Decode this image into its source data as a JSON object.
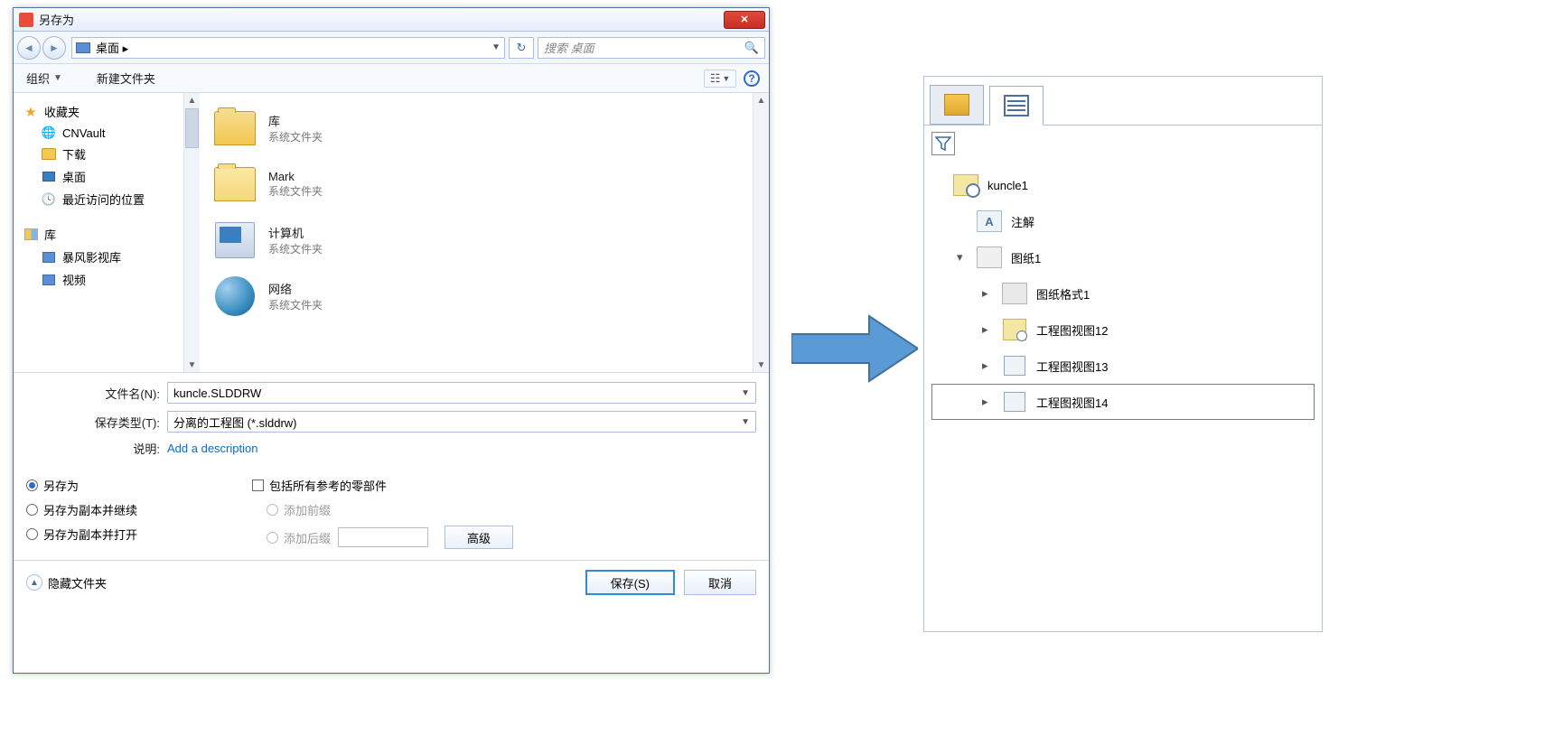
{
  "dialog": {
    "title": "另存为",
    "breadcrumb": "桌面  ▸",
    "search_placeholder": "搜索 桌面",
    "toolbar": {
      "organize": "组织",
      "new_folder": "新建文件夹"
    },
    "sidebar": {
      "favorites": "收藏夹",
      "cnvault": "CNVault",
      "downloads": "下载",
      "desktop": "桌面",
      "recent": "最近访问的位置",
      "library": "库",
      "video_lib": "暴风影视库",
      "video": "视频"
    },
    "files": {
      "lib_name": "库",
      "sys_folder": "系统文件夹",
      "mark": "Mark",
      "computer": "计算机",
      "network": "网络"
    },
    "form": {
      "filename_label": "文件名(N):",
      "filename_value": "kuncle.SLDDRW",
      "type_label": "保存类型(T):",
      "type_value": "分离的工程图 (*.slddrw)",
      "desc_label": "说明:",
      "desc_link": "Add a description"
    },
    "options": {
      "save_as": "另存为",
      "save_copy_continue": "另存为副本并继续",
      "save_copy_open": "另存为副本并打开",
      "include_refs": "包括所有参考的零部件",
      "add_prefix": "添加前缀",
      "add_suffix": "添加后缀",
      "advanced": "高级"
    },
    "footer": {
      "hide_folders": "隐藏文件夹",
      "save": "保存(S)",
      "cancel": "取消"
    }
  },
  "tree": {
    "root": "kuncle1",
    "annotations": "注解",
    "sheet1": "图纸1",
    "sheet_format1": "图纸格式1",
    "view12": "工程图视图12",
    "view13": "工程图视图13",
    "view14": "工程图视图14"
  }
}
